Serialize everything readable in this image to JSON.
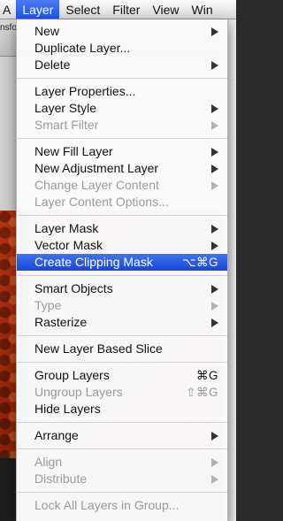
{
  "menubar": {
    "items": [
      {
        "label": "A"
      },
      {
        "label": "Layer"
      },
      {
        "label": "Select"
      },
      {
        "label": "Filter"
      },
      {
        "label": "View"
      },
      {
        "label": "Win"
      }
    ]
  },
  "background": {
    "toolbar_text": "nsfor"
  },
  "menu": {
    "groups": [
      [
        {
          "label": "New",
          "submenu": true,
          "enabled": true
        },
        {
          "label": "Duplicate Layer...",
          "enabled": true
        },
        {
          "label": "Delete",
          "submenu": true,
          "enabled": true
        }
      ],
      [
        {
          "label": "Layer Properties...",
          "enabled": true
        },
        {
          "label": "Layer Style",
          "submenu": true,
          "enabled": true
        },
        {
          "label": "Smart Filter",
          "submenu": true,
          "enabled": false
        }
      ],
      [
        {
          "label": "New Fill Layer",
          "submenu": true,
          "enabled": true
        },
        {
          "label": "New Adjustment Layer",
          "submenu": true,
          "enabled": true
        },
        {
          "label": "Change Layer Content",
          "submenu": true,
          "enabled": false
        },
        {
          "label": "Layer Content Options...",
          "enabled": false
        }
      ],
      [
        {
          "label": "Layer Mask",
          "submenu": true,
          "enabled": true
        },
        {
          "label": "Vector Mask",
          "submenu": true,
          "enabled": true
        },
        {
          "label": "Create Clipping Mask",
          "shortcut": "⌥⌘G",
          "enabled": true,
          "selected": true
        }
      ],
      [
        {
          "label": "Smart Objects",
          "submenu": true,
          "enabled": true
        },
        {
          "label": "Type",
          "submenu": true,
          "enabled": false
        },
        {
          "label": "Rasterize",
          "submenu": true,
          "enabled": true
        }
      ],
      [
        {
          "label": "New Layer Based Slice",
          "enabled": true
        }
      ],
      [
        {
          "label": "Group Layers",
          "shortcut": "⌘G",
          "enabled": true
        },
        {
          "label": "Ungroup Layers",
          "shortcut": "⇧⌘G",
          "enabled": false
        },
        {
          "label": "Hide Layers",
          "enabled": true
        }
      ],
      [
        {
          "label": "Arrange",
          "submenu": true,
          "enabled": true
        }
      ],
      [
        {
          "label": "Align",
          "submenu": true,
          "enabled": false
        },
        {
          "label": "Distribute",
          "submenu": true,
          "enabled": false
        }
      ],
      [
        {
          "label": "Lock All Layers in Group...",
          "enabled": false
        }
      ]
    ]
  }
}
